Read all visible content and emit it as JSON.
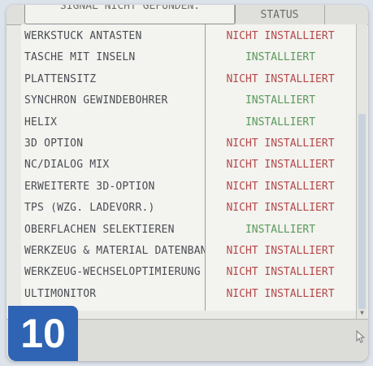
{
  "header": {
    "partial_title": "SIGNAL NICHT GEFUNDEN.",
    "status_label": "STATUS"
  },
  "options": [
    {
      "name": "WERKSTUCK ANTASTEN",
      "status": "NICHT INSTALLIERT",
      "state": "not_installed"
    },
    {
      "name": "TASCHE MIT INSELN",
      "status": "INSTALLIERT",
      "state": "installed"
    },
    {
      "name": "PLATTENSITZ",
      "status": "NICHT INSTALLIERT",
      "state": "not_installed"
    },
    {
      "name": "SYNCHRON GEWINDEBOHRER",
      "status": "INSTALLIERT",
      "state": "installed"
    },
    {
      "name": "HELIX",
      "status": "INSTALLIERT",
      "state": "installed"
    },
    {
      "name": "3D OPTION",
      "status": "NICHT INSTALLIERT",
      "state": "not_installed"
    },
    {
      "name": "NC/DIALOG MIX",
      "status": "NICHT INSTALLIERT",
      "state": "not_installed"
    },
    {
      "name": "ERWEITERTE 3D-OPTION",
      "status": "NICHT INSTALLIERT",
      "state": "not_installed"
    },
    {
      "name": "TPS (WZG. LADEVORR.)",
      "status": "NICHT INSTALLIERT",
      "state": "not_installed"
    },
    {
      "name": "OBERFLÄCHEN SELEKTIEREN",
      "status": "INSTALLIERT",
      "state": "installed"
    },
    {
      "name": "WERKZEUG & MATERIAL DATENBANK",
      "status": "NICHT INSTALLIERT",
      "state": "not_installed"
    },
    {
      "name": "WERKZEUG-WECHSELOPTIMIERUNG",
      "status": "NICHT INSTALLIERT",
      "state": "not_installed"
    },
    {
      "name": "ULTIMONITOR",
      "status": "NICHT INSTALLIERT",
      "state": "not_installed"
    }
  ],
  "badge": {
    "number": "10"
  },
  "colors": {
    "installed": "#5a9a5c",
    "not_installed": "#b5484a",
    "badge": "#2f63b4"
  },
  "icons": {
    "cursor": "mouse-pointer-icon",
    "scroll_down": "arrow-down-icon"
  }
}
